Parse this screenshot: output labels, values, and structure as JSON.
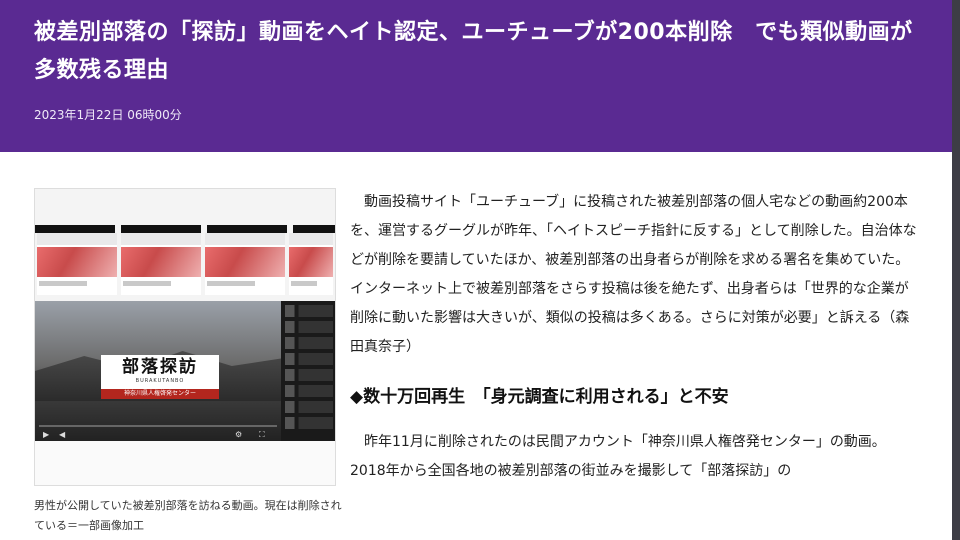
{
  "article": {
    "title": "被差別部落の「探訪」動画をヘイト認定、ユーチューブが200本削除　でも類似動画が多数残る理由",
    "date": "2023年1月22日 06時00分"
  },
  "figure": {
    "card_title": "部落探訪",
    "card_romaji": "BURAKUTANBO",
    "card_band": "神奈川県人権啓発センター",
    "caption": "男性が公開していた被差別部落を訪ねる動画。現在は削除されている＝一部画像加工"
  },
  "body": {
    "para1": "動画投稿サイト「ユーチューブ」に投稿された被差別部落の個人宅などの動画約200本を、運営するグーグルが昨年、「ヘイトスピーチ指針に反する」として削除した。自治体などが削除を要請していたほか、被差別部落の出身者らが削除を求める署名を集めていた。インターネット上で被差別部落をさらす投稿は後を絶たず、出身者らは「世界的な企業が削除に動いた影響は大きいが、類似の投稿は多くある。さらに対策が必要」と訴える（森田真奈子）",
    "subheading": "◆数十万回再生　「身元調査に利用される」と不安",
    "para2": "昨年11月に削除されたのは民間アカウント「神奈川県人権啓発センター」の動画。2018年から全国各地の被差別部落の街並みを撮影して「部落探訪」の"
  },
  "icons": [
    "play-icon",
    "volume-icon",
    "settings-icon",
    "fullscreen-icon"
  ],
  "colors": {
    "header_bg": "#5a2a92",
    "header_text": "#ffffff",
    "band_red": "#b3261e"
  }
}
